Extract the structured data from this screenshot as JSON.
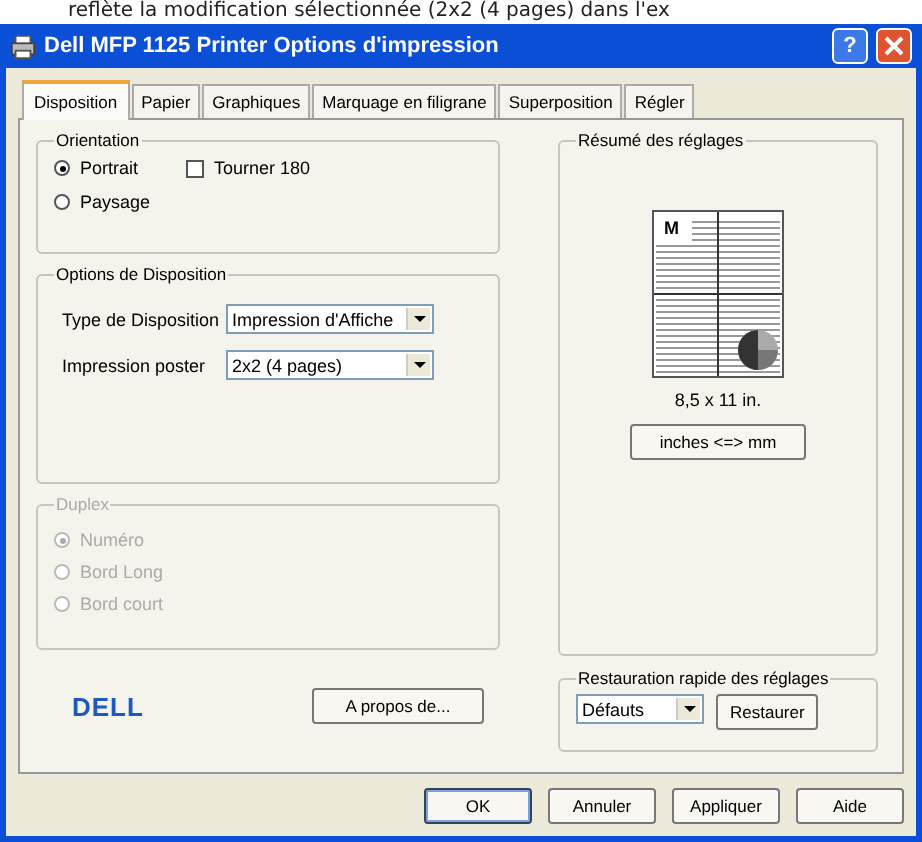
{
  "caption": "reflète la modification sélectionnée (2x2 (4 pages) dans l'ex",
  "window": {
    "title": "Dell MFP 1125 Printer Options d'impression",
    "help": "?"
  },
  "tabs": [
    {
      "label": "Disposition",
      "selected": true
    },
    {
      "label": "Papier",
      "selected": false
    },
    {
      "label": "Graphiques",
      "selected": false
    },
    {
      "label": "Marquage en filigrane",
      "selected": false
    },
    {
      "label": "Superposition",
      "selected": false
    },
    {
      "label": "Régler",
      "selected": false
    }
  ],
  "orientation": {
    "title": "Orientation",
    "options": [
      {
        "label": "Portrait",
        "selected": true
      },
      {
        "label": "Paysage",
        "selected": false
      }
    ],
    "rotate": {
      "label": "Tourner 180",
      "checked": false
    }
  },
  "layout_options": {
    "title": "Options de Disposition",
    "fields": [
      {
        "label": "Type de Disposition",
        "value": "Impression d'Affiche"
      },
      {
        "label": "Impression poster",
        "value": "2x2 (4 pages)"
      }
    ]
  },
  "duplex": {
    "title": "Duplex",
    "disabled": true,
    "options": [
      {
        "label": "Numéro",
        "selected": true
      },
      {
        "label": "Bord Long",
        "selected": false
      },
      {
        "label": "Bord court",
        "selected": false
      }
    ]
  },
  "logo": "DELL",
  "about_button": "A propos de...",
  "summary": {
    "title": "Résumé des réglages",
    "preview_letter": "M",
    "page_size": "8,5 x 11 in.",
    "unit_button": "inches <=> mm"
  },
  "quick_restore": {
    "title": "Restauration rapide des réglages",
    "value": "Défauts",
    "button": "Restaurer"
  },
  "buttons": [
    {
      "label": "OK",
      "default": true
    },
    {
      "label": "Annuler",
      "default": false
    },
    {
      "label": "Appliquer",
      "default": false
    },
    {
      "label": "Aide",
      "default": false
    }
  ]
}
